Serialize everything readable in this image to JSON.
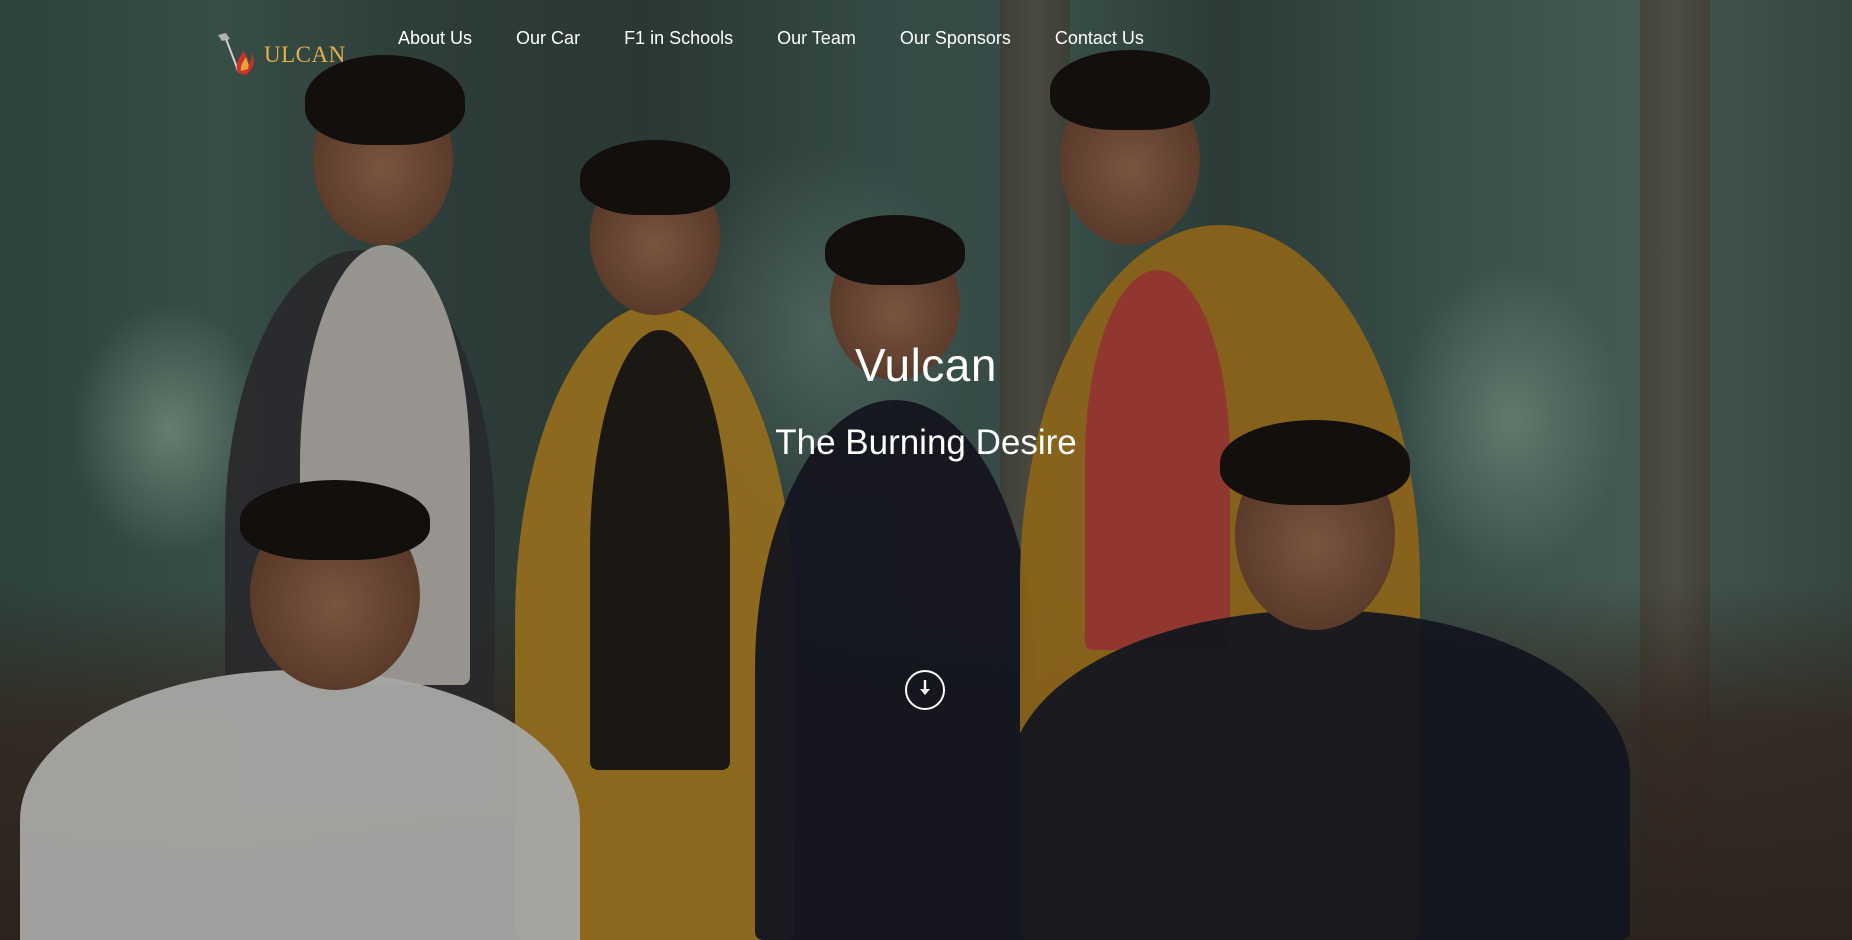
{
  "brand": {
    "logo_text": "ULCAN",
    "accent_color": "#e2b14b"
  },
  "nav": {
    "items": [
      {
        "label": "About Us"
      },
      {
        "label": "Our Car"
      },
      {
        "label": "F1 in Schools"
      },
      {
        "label": "Our Team"
      },
      {
        "label": "Our Sponsors"
      },
      {
        "label": "Contact Us"
      }
    ]
  },
  "hero": {
    "title": "Vulcan",
    "subtitle": "The Burning Desire",
    "scroll_icon": "arrow-down-circle-icon",
    "background_image": "team-photo"
  }
}
